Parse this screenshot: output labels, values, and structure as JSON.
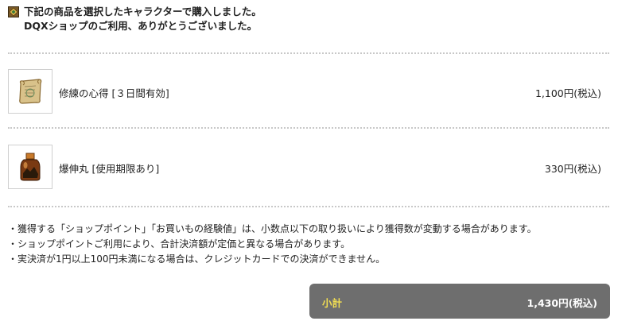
{
  "header": {
    "icon": "shop-emblem-icon",
    "line1": "下記の商品を選択したキャラクターで購入しました。",
    "line2": "DQXショップのご利用、ありがとうございました。"
  },
  "items": [
    {
      "icon": "scroll-icon",
      "name": "修練の心得 [３日間有効]",
      "price": "1,100円(税込)"
    },
    {
      "icon": "potion-bottle-icon",
      "name": "爆伸丸 [使用期限あり]",
      "price": "330円(税込)"
    }
  ],
  "notes": [
    "・獲得する「ショップポイント」「お買いもの経験値」は、小数点以下の取り扱いにより獲得数が変動する場合があります。",
    "・ショップポイントご利用により、合計決済額が定価と異なる場合があります。",
    "・実決済が1円以上100円未満になる場合は、クレジットカードでの決済ができません。"
  ],
  "subtotal": {
    "label": "小計",
    "amount": "1,430円(税込)"
  },
  "colors": {
    "subtotal_bg": "#6e6e6e",
    "subtotal_label": "#f3df52",
    "divider": "#c8c8c8"
  }
}
